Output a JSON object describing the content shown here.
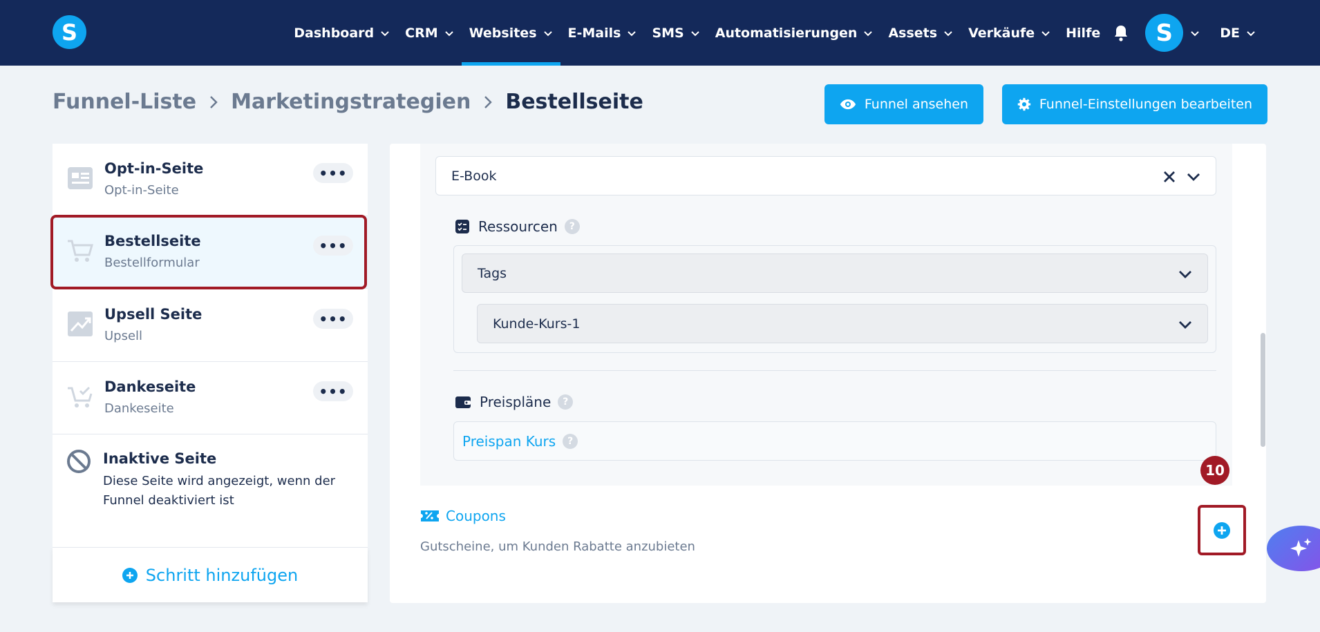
{
  "topbar": {
    "logo_letter": "S",
    "nav": [
      {
        "label": "Dashboard"
      },
      {
        "label": "CRM"
      },
      {
        "label": "Websites",
        "active": true
      },
      {
        "label": "E-Mails"
      },
      {
        "label": "SMS"
      },
      {
        "label": "Automatisierungen"
      },
      {
        "label": "Assets"
      },
      {
        "label": "Verkäufe"
      },
      {
        "label": "Hilfe"
      }
    ],
    "avatar_letter": "S",
    "language": "DE"
  },
  "breadcrumb": {
    "items": [
      "Funnel-Liste",
      "Marketingstrategien"
    ],
    "current": "Bestellseite"
  },
  "actions": {
    "view_funnel": "Funnel ansehen",
    "edit_settings": "Funnel-Einstellungen bearbeiten"
  },
  "steps": [
    {
      "title": "Opt-in-Seite",
      "subtitle": "Opt-in-Seite",
      "icon": "form-page-icon",
      "more": "•••"
    },
    {
      "title": "Bestellseite",
      "subtitle": "Bestellformular",
      "icon": "cart-icon",
      "more": "•••",
      "selected": true
    },
    {
      "title": "Upsell Seite",
      "subtitle": "Upsell",
      "icon": "trend-up-icon",
      "more": "•••"
    },
    {
      "title": "Dankeseite",
      "subtitle": "Dankeseite",
      "icon": "cart-check-icon",
      "more": "•••"
    }
  ],
  "inactive_step": {
    "title": "Inaktive Seite",
    "description": "Diese Seite wird angezeigt, wenn der Funnel deaktiviert ist"
  },
  "add_step_label": "Schritt hinzufügen",
  "product": {
    "selected": "E-Book",
    "resources_label": "Ressourcen",
    "resources_select": "Tags",
    "resources_value": "Kunde-Kurs-1",
    "price_plans_label": "Preispläne",
    "price_plan": "Preispan Kurs",
    "help_glyph": "?"
  },
  "coupons": {
    "label": "Coupons",
    "description": "Gutscheine, um Kunden Rabatte anzubieten"
  },
  "annotation": {
    "step_number": "10"
  },
  "colors": {
    "topbar": "#14295a",
    "accent": "#0ea5f0",
    "highlight": "#a11a26",
    "background": "#eff3f7"
  }
}
